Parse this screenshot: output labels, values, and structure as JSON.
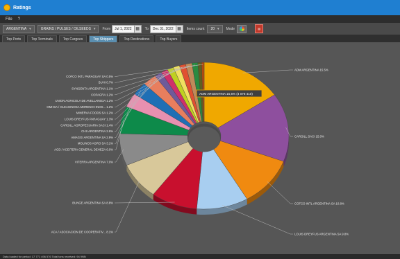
{
  "window": {
    "title": "Ratings"
  },
  "menu": {
    "file": "File",
    "help": "?"
  },
  "toolbar": {
    "country": "ARGENTINA",
    "commodity": "GRAINS / PULSES / OILSEEDS",
    "from_label": "From",
    "from_date": "Jul 1, 2022",
    "to_label": "To",
    "to_date": "Dec 31, 2022",
    "items_count_label": "Items count",
    "items_count": "20",
    "mode_label": "Mode"
  },
  "tabs": [
    "Top Ports",
    "Top Terminals",
    "Top Cargoes",
    "Top Shippers",
    "Top Destinations",
    "Top Buyers"
  ],
  "active_tab": 3,
  "tooltip": "ADM ARGENTINA 15,5% (4 078 410)",
  "status": "Data loaded for period: 17 771 496 576 Total tons received: 94 998t",
  "icons": {
    "calendar": "calendar-icon",
    "palette": "color-palette-icon",
    "pdf": "pdf-export-icon",
    "app": "app-icon",
    "dropdown": "chevron-down-icon"
  },
  "chart_data": {
    "type": "pie",
    "style": "3D donut",
    "labels": [
      "ADM ARGENTINA",
      "CARGILL SACI",
      "COFCO INTL ARGENTINA SA",
      "LOUIS DREYFUS ARGENTINA SA",
      "BUNGE ARGENTINA SA",
      "ACA / ASOCIACION DE COOPERATIV...",
      "VITERRA ARGENTINA",
      "AGD / ACEITERA GENERAL DEHEZA",
      "MOLINOS AGRO SA",
      "AMAGGI ARGENTINA SA",
      "CHS ARGENTINA",
      "CARGILL AGROPECUARIA SACI",
      "LOUIS DREYFUS PARAGUAY",
      "MINERVA FOODS SA",
      "OMHSA / OLEAGINOSA MORENO HNOS...",
      "UNION AGRICOLA DE AVELLANEDA",
      "COPAGRA",
      "SYNGENTA ARGENTINA",
      "BUHI",
      "COFCO INTL PARAGUAY SA"
    ],
    "display_labels": [
      "ADM ARGENTINA 15.5%",
      "CARGILL SACI 15.0%",
      "COFCO INTL ARGENTINA SA 10.8%",
      "LOUIS DREYFUS ARGENTINA SA 9.8%",
      "BUNGE ARGENTINA SA 8.8%",
      "ACA / ASOCIACION DE COOPERATIV... 8.1%",
      "VITERRA ARGENTINA 7.0%",
      "AGD / ACEITERA GENERAL DEHEZA 6.0%",
      "MOLINOS AGRO SA 3.1%",
      "AMAGGI ARGENTINA SA 2.9%",
      "CHS ARGENTINA 2.6%",
      "CARGILL AGROPECUARIA SACI 1.4%",
      "LOUIS DREYFUS PARAGUAY 1.3%",
      "MINERVA FOODS SA 1.2%",
      "OMHSA / OLEAGINOSA MORENO HNOS... 1.2%",
      "UNION AGRICOLA DE AVELLANEDA 1.2%",
      "COPAGRA 1.2%",
      "SYNGENTA ARGENTINA 1.1%",
      "BUHI 0.7%",
      "COFCO INTL PARAGUAY SA 0.5%"
    ],
    "values": [
      15.5,
      15.0,
      10.8,
      9.8,
      8.8,
      8.1,
      7.0,
      6.0,
      3.1,
      2.9,
      2.6,
      1.4,
      1.3,
      1.2,
      1.2,
      1.2,
      1.2,
      1.1,
      0.7,
      0.5
    ],
    "colors": [
      "#f0a800",
      "#8e4f9e",
      "#f08a10",
      "#a8cef0",
      "#c8102e",
      "#d8c89a",
      "#8a8a8a",
      "#0d8a4a",
      "#e890b0",
      "#1f6fb5",
      "#e87e5e",
      "#6f5a9a",
      "#d0306a",
      "#c0d020",
      "#f0e060",
      "#e05030",
      "#c08a5a",
      "#2a8a40",
      "#606020",
      "#b04a10"
    ]
  }
}
